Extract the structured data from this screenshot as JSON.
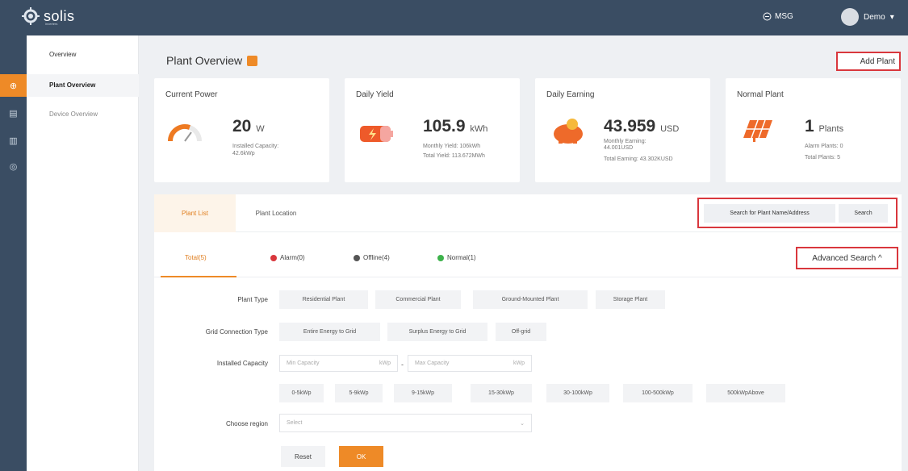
{
  "header": {
    "brand": "solis",
    "brand_sub": "inverters",
    "msg_label": "MSG",
    "user_name": "Demo"
  },
  "sidenav": {
    "items": [
      {
        "label": "Overview"
      },
      {
        "label": "Plant Overview"
      },
      {
        "label": "Device Overview"
      }
    ]
  },
  "page": {
    "title": "Plant Overview",
    "add_plant_label": "Add Plant"
  },
  "cards": {
    "current_power": {
      "title": "Current Power",
      "value": "20",
      "unit": "W",
      "sub1": "Installed Capacity:",
      "sub2": "42.6kWp"
    },
    "daily_yield": {
      "title": "Daily Yield",
      "value": "105.9",
      "unit": "kWh",
      "sub1": "Monthly Yield: 106kWh",
      "sub2": "Total Yield: 113.672MWh"
    },
    "daily_earning": {
      "title": "Daily Earning",
      "value": "43.959",
      "unit": "USD",
      "sub1": "Monthly Earning:",
      "sub2": "44.001USD",
      "sub3": "Total Earning: 43.302KUSD"
    },
    "normal_plant": {
      "title": "Normal Plant",
      "value": "1",
      "unit": "Plants",
      "sub1": "Alarm Plants: 0",
      "sub2": "Total Plants: 5"
    }
  },
  "panel": {
    "tabs": [
      {
        "label": "Plant List"
      },
      {
        "label": "Plant Location"
      }
    ],
    "search": {
      "placeholder": "Search for Plant Name/Address",
      "button_label": "Search"
    },
    "status_tabs": [
      {
        "label": "Total(5)"
      },
      {
        "label": "Alarm(0)",
        "color": "#d9373d"
      },
      {
        "label": "Offline(4)",
        "color": "#555555"
      },
      {
        "label": "Normal(1)",
        "color": "#3db24b"
      }
    ],
    "advanced_label": "Advanced Search ^",
    "filters": {
      "plant_type_label": "Plant Type",
      "plant_types": [
        "Residential Plant",
        "Commercial Plant",
        "Ground-Mounted Plant",
        "Storage Plant"
      ],
      "grid_label": "Grid Connection Type",
      "grid_types": [
        "Entire Energy to Grid",
        "Surplus Energy to Grid",
        "Off-grid"
      ],
      "capacity_label": "Installed Capacity",
      "min_placeholder": "Min Capacity",
      "max_placeholder": "Max Capacity",
      "unit": "kWp",
      "capacity_ranges": [
        "0-5kWp",
        "5-9kWp",
        "9-15kWp",
        "15-30kWp",
        "30-100kWp",
        "100-500kWp",
        "500kWpAbove"
      ],
      "region_label": "Choose region",
      "region_placeholder": "Select",
      "reset_label": "Reset",
      "ok_label": "OK"
    }
  },
  "colors": {
    "accent": "#ee8a27",
    "topbar": "#3a4d63",
    "highlight_border": "#d9373d"
  }
}
